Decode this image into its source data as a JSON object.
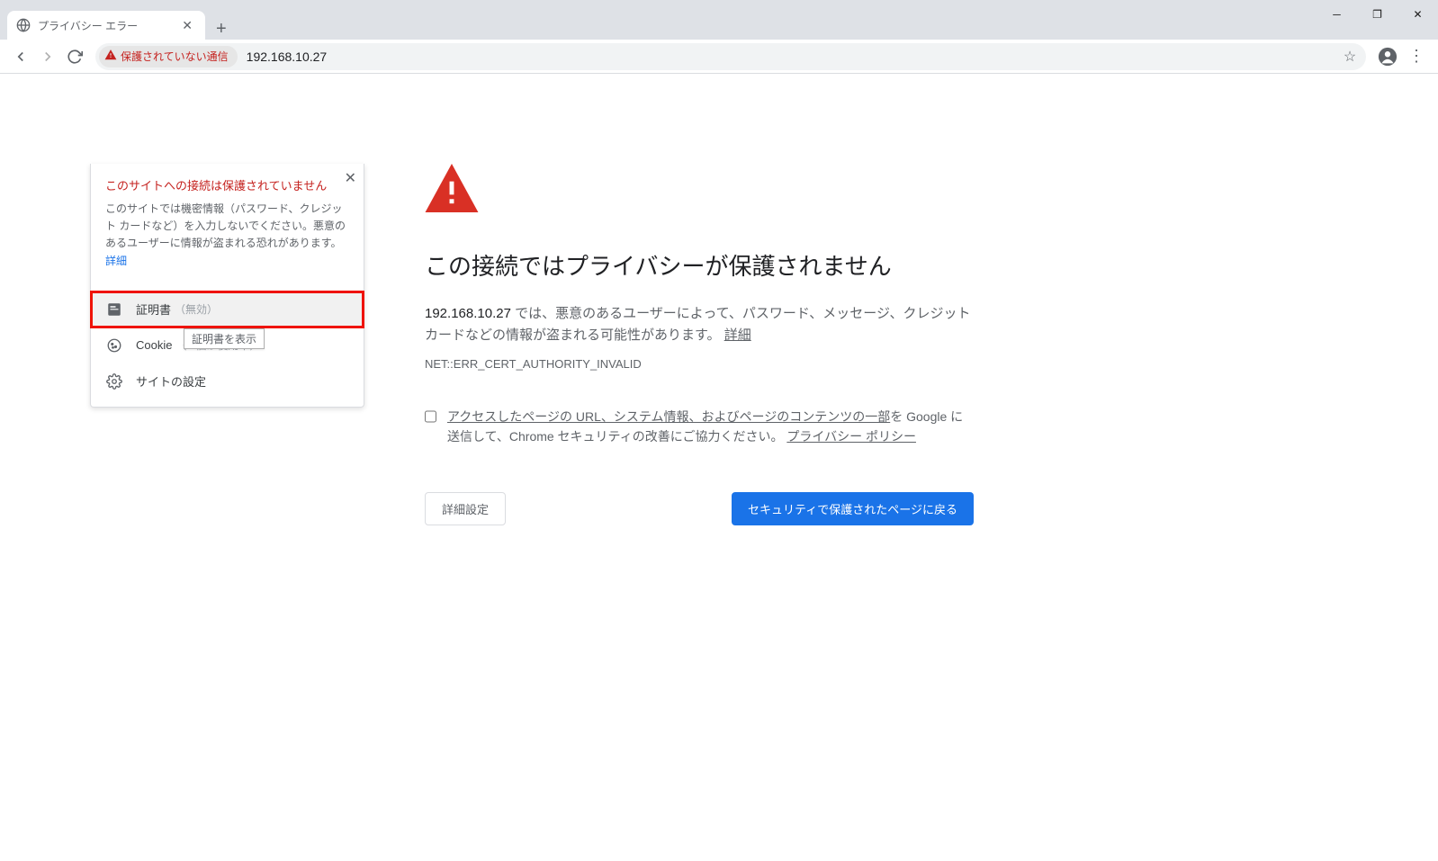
{
  "tab": {
    "title": "プライバシー エラー"
  },
  "window": {
    "minimize": "─",
    "maximize": "❐",
    "close": "✕"
  },
  "toolbar": {
    "security_chip": "保護されていない通信",
    "url": "192.168.10.27"
  },
  "site_info": {
    "title": "このサイトへの接続は保護されていません",
    "desc_1": "このサイトでは機密情報（パスワード、クレジット カードなど）を入力しないでください。悪意のあるユーザーに情報が盗まれる恐れがあります。",
    "desc_link": "詳細",
    "rows": {
      "cert_label": "証明書",
      "cert_sub": "（無効）",
      "cookie_label": "Cookie",
      "cookie_sub": "（0 個が使用中）",
      "settings_label": "サイトの設定"
    },
    "tooltip": "証明書を表示"
  },
  "page": {
    "headline": "この接続ではプライバシーが保護されません",
    "ip": "192.168.10.27",
    "body_1": " では、悪意のあるユーザーによって、パスワード、メッセージ、クレジット カードなどの情報が盗まれる可能性があります。",
    "details_link": "詳細",
    "error_code": "NET::ERR_CERT_AUTHORITY_INVALID",
    "optin_link": "アクセスしたページの URL、システム情報、およびページのコンテンツの一部",
    "optin_1": "を Google に送信して、Chrome セキュリティの改善にご協力ください。",
    "privacy_link": "プライバシー ポリシー",
    "advanced_btn": "詳細設定",
    "back_btn": "セキュリティで保護されたページに戻る"
  }
}
